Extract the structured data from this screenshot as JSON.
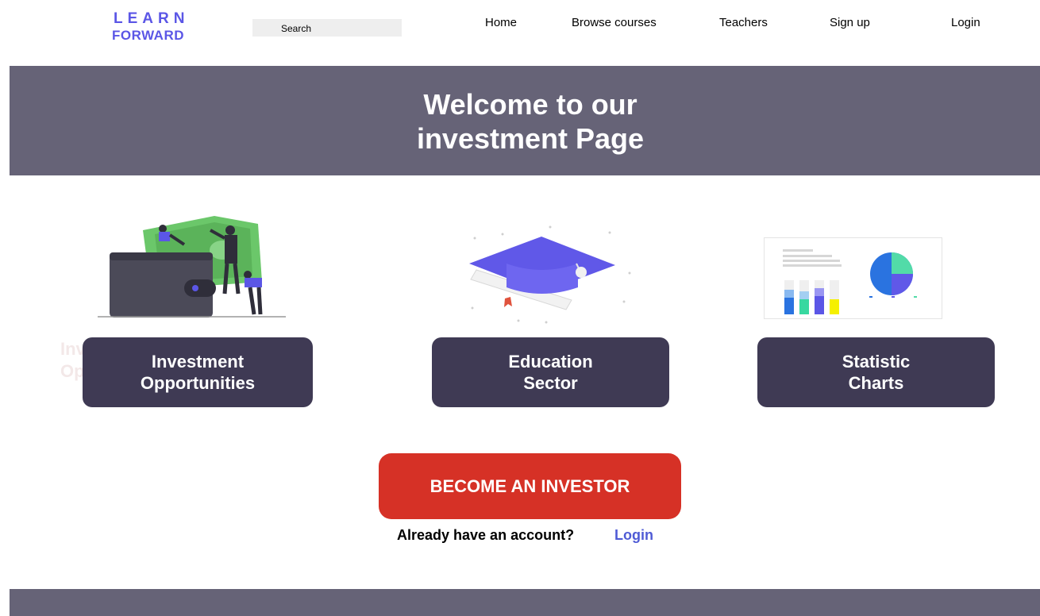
{
  "logo": {
    "line1": "LEARN",
    "line2": "FORWARD"
  },
  "search": {
    "placeholder": "Search"
  },
  "nav": {
    "home": "Home",
    "browse": "Browse courses",
    "teachers": "Teachers",
    "signup": "Sign up",
    "login": "Login"
  },
  "banner": {
    "line1": "Welcome to our",
    "line2": "investment Page"
  },
  "cards": {
    "investment": {
      "line1": "Investment",
      "line2": "Opportunities"
    },
    "education": {
      "line1": "Education",
      "line2": "Sector"
    },
    "statistics": {
      "line1": "Statistic",
      "line2": "Charts"
    }
  },
  "cta": {
    "label": "BECOME AN INVESTOR",
    "prompt": "Already have an account?",
    "login": "Login"
  },
  "colors": {
    "brand": "#5b56e6",
    "banner": "#666377",
    "card": "#3f3a54",
    "cta": "#d63126",
    "link": "#4f5bd5"
  }
}
